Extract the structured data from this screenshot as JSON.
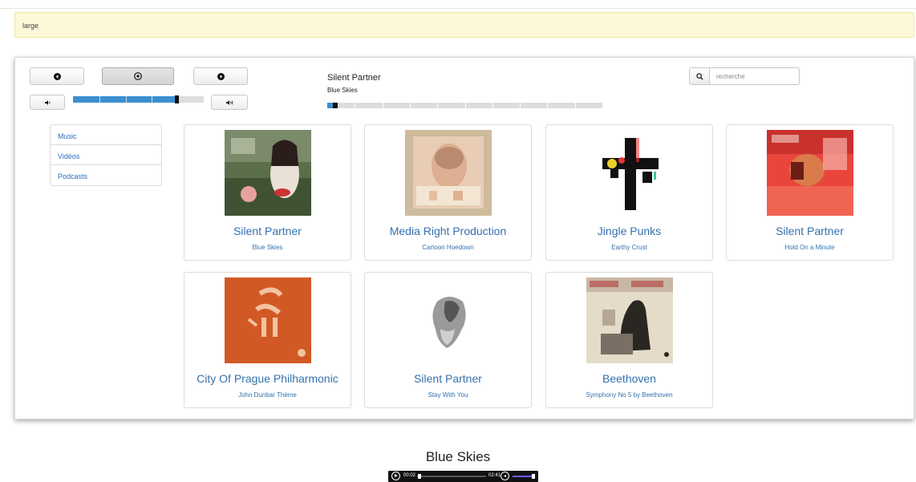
{
  "alert": {
    "text": "large"
  },
  "controls": {
    "prev_icon": "prev-circle-icon",
    "play_icon": "play-circle-icon",
    "next_icon": "next-circle-icon",
    "vol_down_icon": "volume-down-icon",
    "vol_up_icon": "volume-up-icon",
    "volume_level": 0.8
  },
  "now_playing": {
    "artist": "Silent Partner",
    "title": "Blue Skies",
    "progress": 0.02
  },
  "search": {
    "placeholder": "recherche",
    "icon": "search-icon"
  },
  "nav": {
    "items": [
      {
        "label": "Music"
      },
      {
        "label": "Vidéos"
      },
      {
        "label": "Podcasts"
      }
    ]
  },
  "albums": [
    {
      "artist": "Silent Partner",
      "title": "Blue Skies"
    },
    {
      "artist": "Media Right Production",
      "title": "Cartoon Hoedown"
    },
    {
      "artist": "Jingle Punks",
      "title": "Earthy Crust"
    },
    {
      "artist": "Silent Partner",
      "title": "Hold On a Minute"
    },
    {
      "artist": "City Of Prague Philharmonic",
      "title": "John Dunbar Thème"
    },
    {
      "artist": "Silent Partner",
      "title": "Stay With You"
    },
    {
      "artist": "Beethoven",
      "title": "Symphony No 5 by Beethoven"
    }
  ],
  "audio": {
    "title": "Blue Skies",
    "current_time": "00:02",
    "duration": "02:41",
    "position": 0.01,
    "volume": 1.0
  },
  "colors": {
    "accent": "#3b8fd0",
    "link": "#3471ad",
    "alert_bg": "#fcf8d8"
  }
}
